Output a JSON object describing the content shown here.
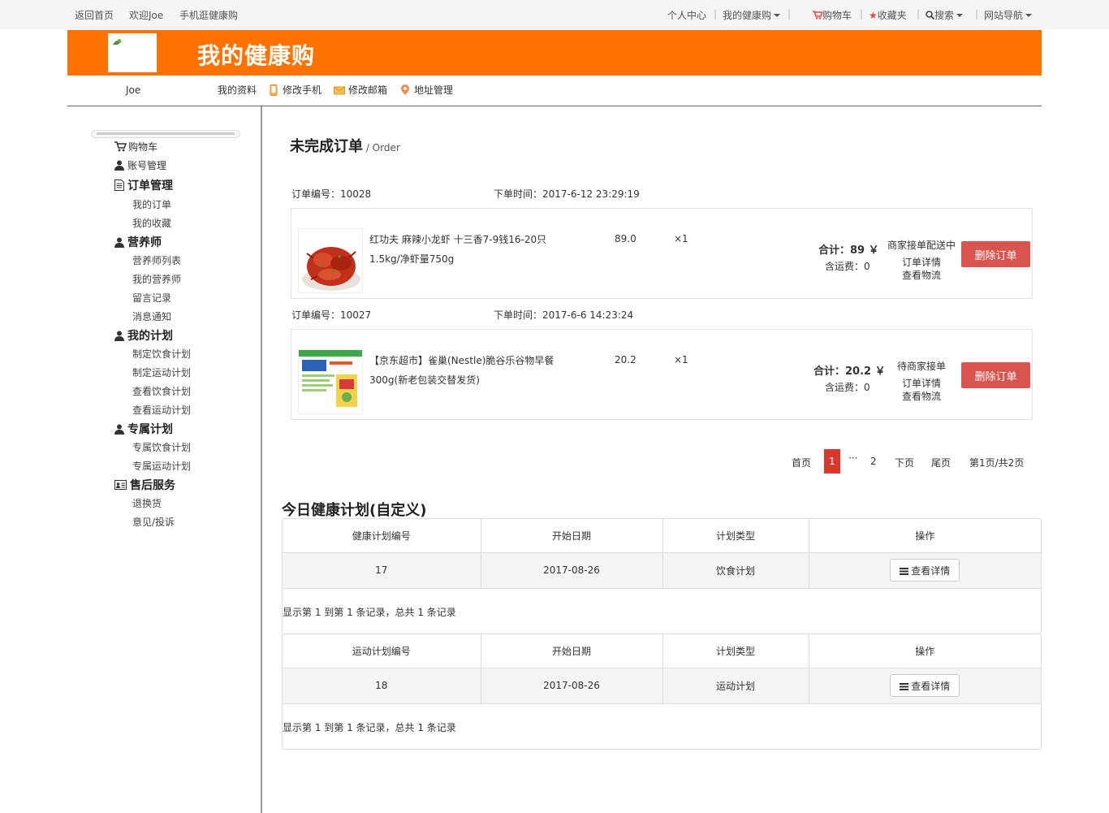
{
  "topbar": {
    "home": "返回首页",
    "welcome": "欢迎Joe",
    "mobile": "手机逛健康购",
    "personal_center": "个人中心",
    "my_health": "我的健康购",
    "cart": "购物车",
    "favorites": "收藏夹",
    "search": "搜索",
    "site_nav": "网站导航"
  },
  "banner": {
    "title": "我的健康购",
    "brand_color": "#ff7200"
  },
  "subnav": {
    "username": "Joe",
    "profile": "我的资料",
    "change_phone": "修改手机",
    "change_email": "修改邮箱",
    "address": "地址管理"
  },
  "sidebar": {
    "cart": "购物车",
    "account": "账号管理",
    "orders_head": "订单管理",
    "my_orders": "我的订单",
    "my_favorites": "我的收藏",
    "nutritionist_head": "营养师",
    "nutritionist_list": "营养师列表",
    "my_nutritionist": "我的营养师",
    "message_log": "留言记录",
    "notifications": "消息通知",
    "plan_head": "我的计划",
    "make_diet_plan": "制定饮食计划",
    "make_sport_plan": "制定运动计划",
    "view_diet_plan": "查看饮食计划",
    "view_sport_plan": "查看运动计划",
    "exclusive_head": "专属计划",
    "exclusive_diet": "专属饮食计划",
    "exclusive_sport": "专属运动计划",
    "aftersale_head": "售后服务",
    "return": "退换货",
    "complaint": "意见/投诉"
  },
  "orders": {
    "title": "未完成订单",
    "subtitle": "/ Order",
    "list": [
      {
        "order_no": "订单编号：10028",
        "time": "下单时间：2017-6-12 23:29:19",
        "name_line1": "红功夫 麻辣小龙虾 十三香7-9钱16-20只",
        "name_line2": "1.5kg/净虾量750g",
        "price": "89.0",
        "qty": "×1",
        "total_label": "合计：",
        "total_value": "89 ￥",
        "shipping": "含运费：0",
        "status": "商家接单配送中",
        "detail": "订单详情",
        "logistics": "查看物流",
        "delete": "删除订单"
      },
      {
        "order_no": "订单编号：10027",
        "time": "下单时间：2017-6-6 14:23:24",
        "name_line1": "【京东超市】雀巢(Nestle)脆谷乐谷物早餐",
        "name_line2": "300g(新老包装交替发货)",
        "price": "20.2",
        "qty": "×1",
        "total_label": "合计：",
        "total_value": "20.2 ￥",
        "shipping": "含运费：0",
        "status": "待商家接单",
        "detail": "订单详情",
        "logistics": "查看物流",
        "delete": "删除订单"
      }
    ]
  },
  "pagination": {
    "first": "首页",
    "current": "1",
    "ellipsis": "···",
    "page2": "2",
    "next": "下页",
    "last": "尾页",
    "info": "第1页/共2页"
  },
  "plans": {
    "title": "今日健康计划(自定义)",
    "diet": {
      "headers": [
        "健康计划编号",
        "开始日期",
        "计划类型",
        "操作"
      ],
      "row": [
        "17",
        "2017-08-26",
        "饮食计划"
      ],
      "button": "查看详情",
      "footer": "显示第 1 到第 1 条记录，总共 1 条记录"
    },
    "sport": {
      "headers": [
        "运动计划编号",
        "开始日期",
        "计划类型",
        "操作"
      ],
      "row": [
        "18",
        "2017-08-26",
        "运动计划"
      ],
      "button": "查看详情",
      "footer": "显示第 1 到第 1 条记录，总共 1 条记录"
    }
  }
}
